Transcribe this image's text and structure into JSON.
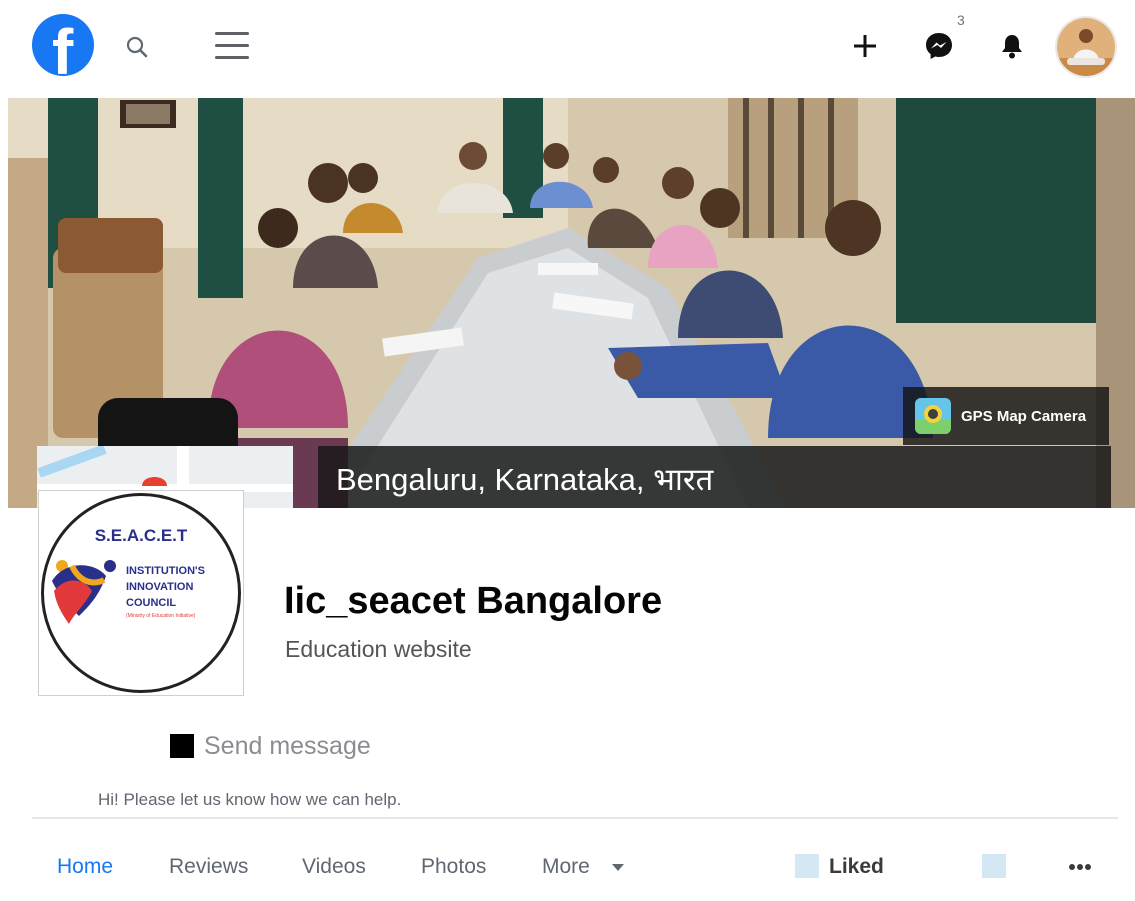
{
  "topbar": {
    "logo_letter": "f",
    "messenger_badge": "3"
  },
  "cover": {
    "gps_label": "GPS Map Camera",
    "location": "Bengaluru, Karnataka, भारत"
  },
  "profile": {
    "logo_acronym": "S.E.A.C.E.T",
    "logo_line1": "INSTITUTION'S",
    "logo_line2": "INNOVATION",
    "logo_line3": "COUNCIL",
    "logo_subline": "(Ministry of Education Initiative)"
  },
  "page": {
    "title": "Iic_seacet Bangalore",
    "category": "Education website",
    "send_message": "Send message",
    "help_text": "Hi! Please let us know how we can help."
  },
  "tabs": [
    {
      "label": "Home"
    },
    {
      "label": "Reviews"
    },
    {
      "label": "Videos"
    },
    {
      "label": "Photos"
    },
    {
      "label": "More"
    }
  ],
  "actions": {
    "liked": "Liked"
  },
  "colors": {
    "brand": "#1877f2",
    "muted_text": "#606770"
  },
  "icons": [
    "search-icon",
    "menu-icon",
    "plus-icon",
    "messenger-icon",
    "bell-icon",
    "more-dots-icon",
    "caret-down-icon"
  ]
}
